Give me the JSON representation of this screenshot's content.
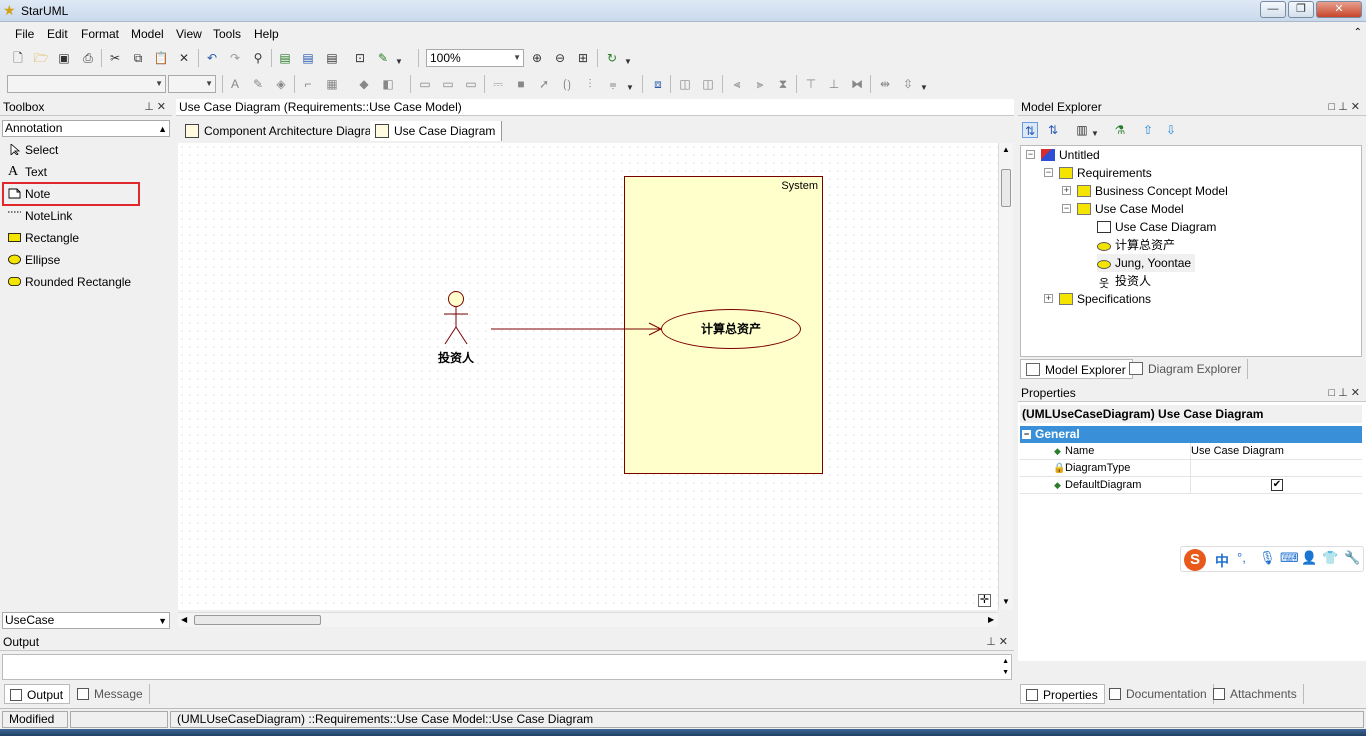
{
  "window": {
    "title": "StarUML",
    "minimize": "—",
    "restore": "❐",
    "close": "✕"
  },
  "menu": [
    "File",
    "Edit",
    "Format",
    "Model",
    "View",
    "Tools",
    "Help"
  ],
  "toolbar": {
    "zoom": "100%"
  },
  "toolbox": {
    "title": "Toolbox",
    "group": "Annotation",
    "items": [
      {
        "label": "Select"
      },
      {
        "label": "Text"
      },
      {
        "label": "Note"
      },
      {
        "label": "NoteLink"
      },
      {
        "label": "Rectangle"
      },
      {
        "label": "Ellipse"
      },
      {
        "label": "Rounded Rectangle"
      }
    ],
    "bottom_group": "UseCase"
  },
  "diagram": {
    "header": "Use Case Diagram (Requirements::Use Case Model)",
    "tabs": [
      "Component Architecture Diagram",
      "Use Case Diagram"
    ],
    "system_label": "System",
    "actor_name": "投资人",
    "usecase_name": "计算总资产"
  },
  "model_explorer": {
    "title": "Model Explorer",
    "tree": {
      "root": "Untitled",
      "requirements": "Requirements",
      "business": "Business Concept Model",
      "usecase_model": "Use Case Model",
      "uc_diagram": "Use Case Diagram",
      "uc1": "计算总资产",
      "uc2": "Jung, Yoontae",
      "actor": "投资人",
      "specifications": "Specifications"
    },
    "tabs": [
      "Model Explorer",
      "Diagram Explorer"
    ]
  },
  "properties": {
    "title": "Properties",
    "subject": "(UMLUseCaseDiagram) Use Case Diagram",
    "section": "General",
    "rows": [
      {
        "name": "Name",
        "value": "Use Case Diagram"
      },
      {
        "name": "DiagramType",
        "value": ""
      },
      {
        "name": "DefaultDiagram",
        "value": "✔"
      }
    ],
    "tabs": [
      "Properties",
      "Documentation",
      "Attachments"
    ]
  },
  "output": {
    "title": "Output",
    "tabs": [
      "Output",
      "Message"
    ]
  },
  "status": {
    "mode": "Modified",
    "path": "(UMLUseCaseDiagram) ::Requirements::Use Case Model::Use Case Diagram"
  },
  "ime": {
    "mode": "中"
  },
  "colors": {
    "accent": "#3a8fd9",
    "note_highlight": "#e0282c",
    "system_fill": "#ffffcc",
    "actor_fill": "#ffffcc"
  }
}
